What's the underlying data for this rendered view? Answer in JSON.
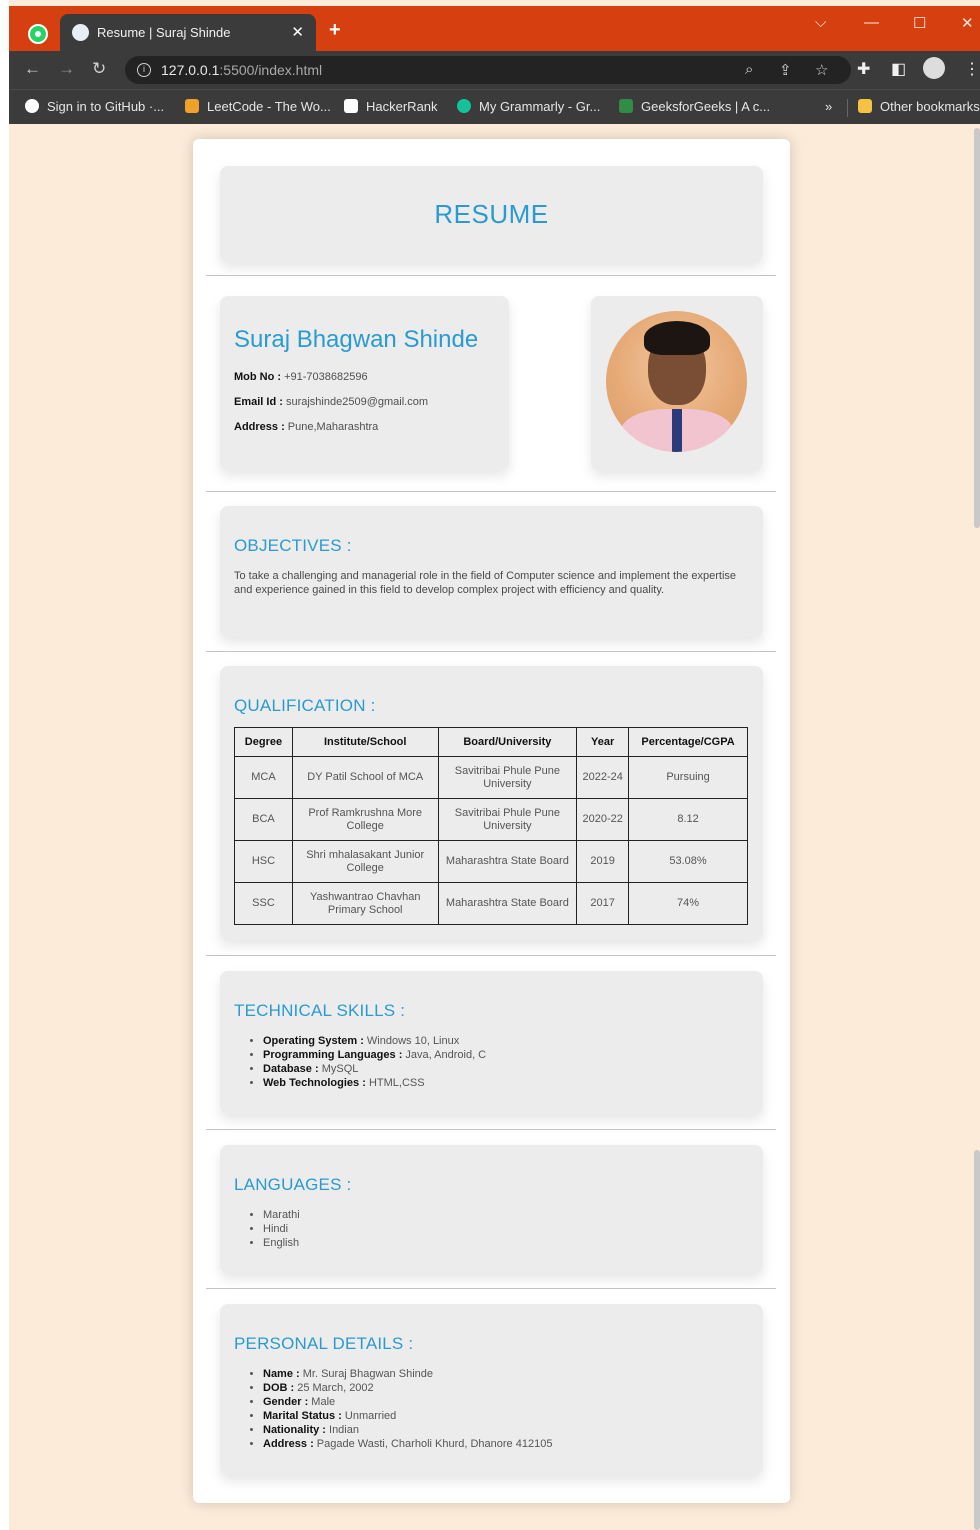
{
  "browser": {
    "tab_title": "Resume | Suraj Shinde",
    "url_host": "127.0.0.1",
    "url_rest": ":5500/index.html",
    "bookmarks": [
      "Sign in to GitHub ·...",
      "LeetCode - The Wo...",
      "HackerRank",
      "My Grammarly - Gr...",
      "GeeksforGeeks | A c..."
    ],
    "overflow": "»",
    "other_bookmarks": "Other bookmarks"
  },
  "resume": {
    "title": "RESUME",
    "name": "Suraj Bhagwan Shinde",
    "mob_label": "Mob No :",
    "mob_value": " +91-7038682596",
    "email_label": "Email Id :",
    "email_value": " surajshinde2509@gmail.com",
    "address_label": "Address :",
    "address_value": " Pune,Maharashtra",
    "objectives": {
      "title": "OBJECTIVES :",
      "text": "To take a challenging and managerial role in the field of Computer science and implement the expertise and experience gained in this field to develop complex project with efficiency and quality."
    },
    "qualification": {
      "title": "QUALIFICATION :",
      "headers": [
        "Degree",
        "Institute/School",
        "Board/University",
        "Year",
        "Percentage/CGPA"
      ],
      "rows": [
        [
          "MCA",
          "DY Patil School of MCA",
          "Savitribai Phule Pune University",
          "2022-24",
          "Pursuing"
        ],
        [
          "BCA",
          "Prof Ramkrushna More College",
          "Savitribai Phule Pune University",
          "2020-22",
          "8.12"
        ],
        [
          "HSC",
          "Shri mhalasakant Junior College",
          "Maharashtra State Board",
          "2019",
          "53.08%"
        ],
        [
          "SSC",
          "Yashwantrao Chavhan Primary School",
          "Maharashtra State Board",
          "2017",
          "74%"
        ]
      ]
    },
    "skills": {
      "title": "TECHNICAL SKILLS :",
      "items": [
        {
          "label": "Operating System :",
          "value": " Windows 10, Linux"
        },
        {
          "label": "Programming Languages :",
          "value": " Java, Android, C"
        },
        {
          "label": "Database :",
          "value": " MySQL"
        },
        {
          "label": "Web Technologies :",
          "value": " HTML,CSS"
        }
      ]
    },
    "languages": {
      "title": "LANGUAGES :",
      "items": [
        "Marathi",
        "Hindi",
        "English"
      ]
    },
    "personal": {
      "title": "PERSONAL DETAILS :",
      "items": [
        {
          "label": "Name :",
          "value": " Mr. Suraj Bhagwan Shinde"
        },
        {
          "label": "DOB :",
          "value": " 25 March, 2002"
        },
        {
          "label": "Gender :",
          "value": " Male"
        },
        {
          "label": "Marital Status :",
          "value": " Unmarried"
        },
        {
          "label": "Nationality :",
          "value": " Indian"
        },
        {
          "label": "Address :",
          "value": " Pagade Wasti, Charholi Khurd, Dhanore 412105"
        }
      ]
    }
  }
}
